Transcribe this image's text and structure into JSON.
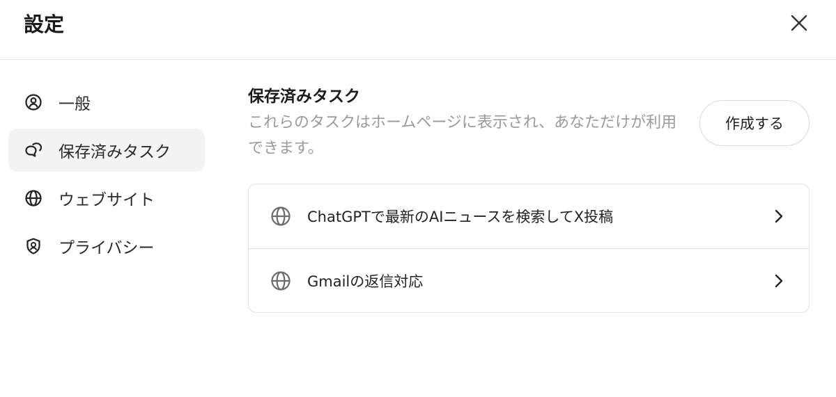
{
  "header": {
    "title": "設定",
    "close_icon": "close-icon"
  },
  "sidebar": {
    "items": [
      {
        "label": "一般",
        "icon": "user-circle-icon",
        "active": false
      },
      {
        "label": "保存済みタスク",
        "icon": "chat-bubbles-icon",
        "active": true
      },
      {
        "label": "ウェブサイト",
        "icon": "globe-icon",
        "active": false
      },
      {
        "label": "プライバシー",
        "icon": "shield-user-icon",
        "active": false
      }
    ]
  },
  "main": {
    "section_title": "保存済みタスク",
    "section_description": "これらのタスクはホームページに表示され、あなただけが利用できます。",
    "create_button_label": "作成する",
    "tasks": [
      {
        "label": "ChatGPTで最新のAIニュースを検索してX投稿",
        "icon": "globe-icon",
        "action_icon": "chevron-right-icon"
      },
      {
        "label": "Gmailの返信対応",
        "icon": "globe-icon",
        "action_icon": "chevron-right-icon"
      }
    ]
  },
  "colors": {
    "active_nav_bg": "#f3f3f3",
    "muted_text": "#9a9a9a",
    "border": "#e2e2e2"
  }
}
